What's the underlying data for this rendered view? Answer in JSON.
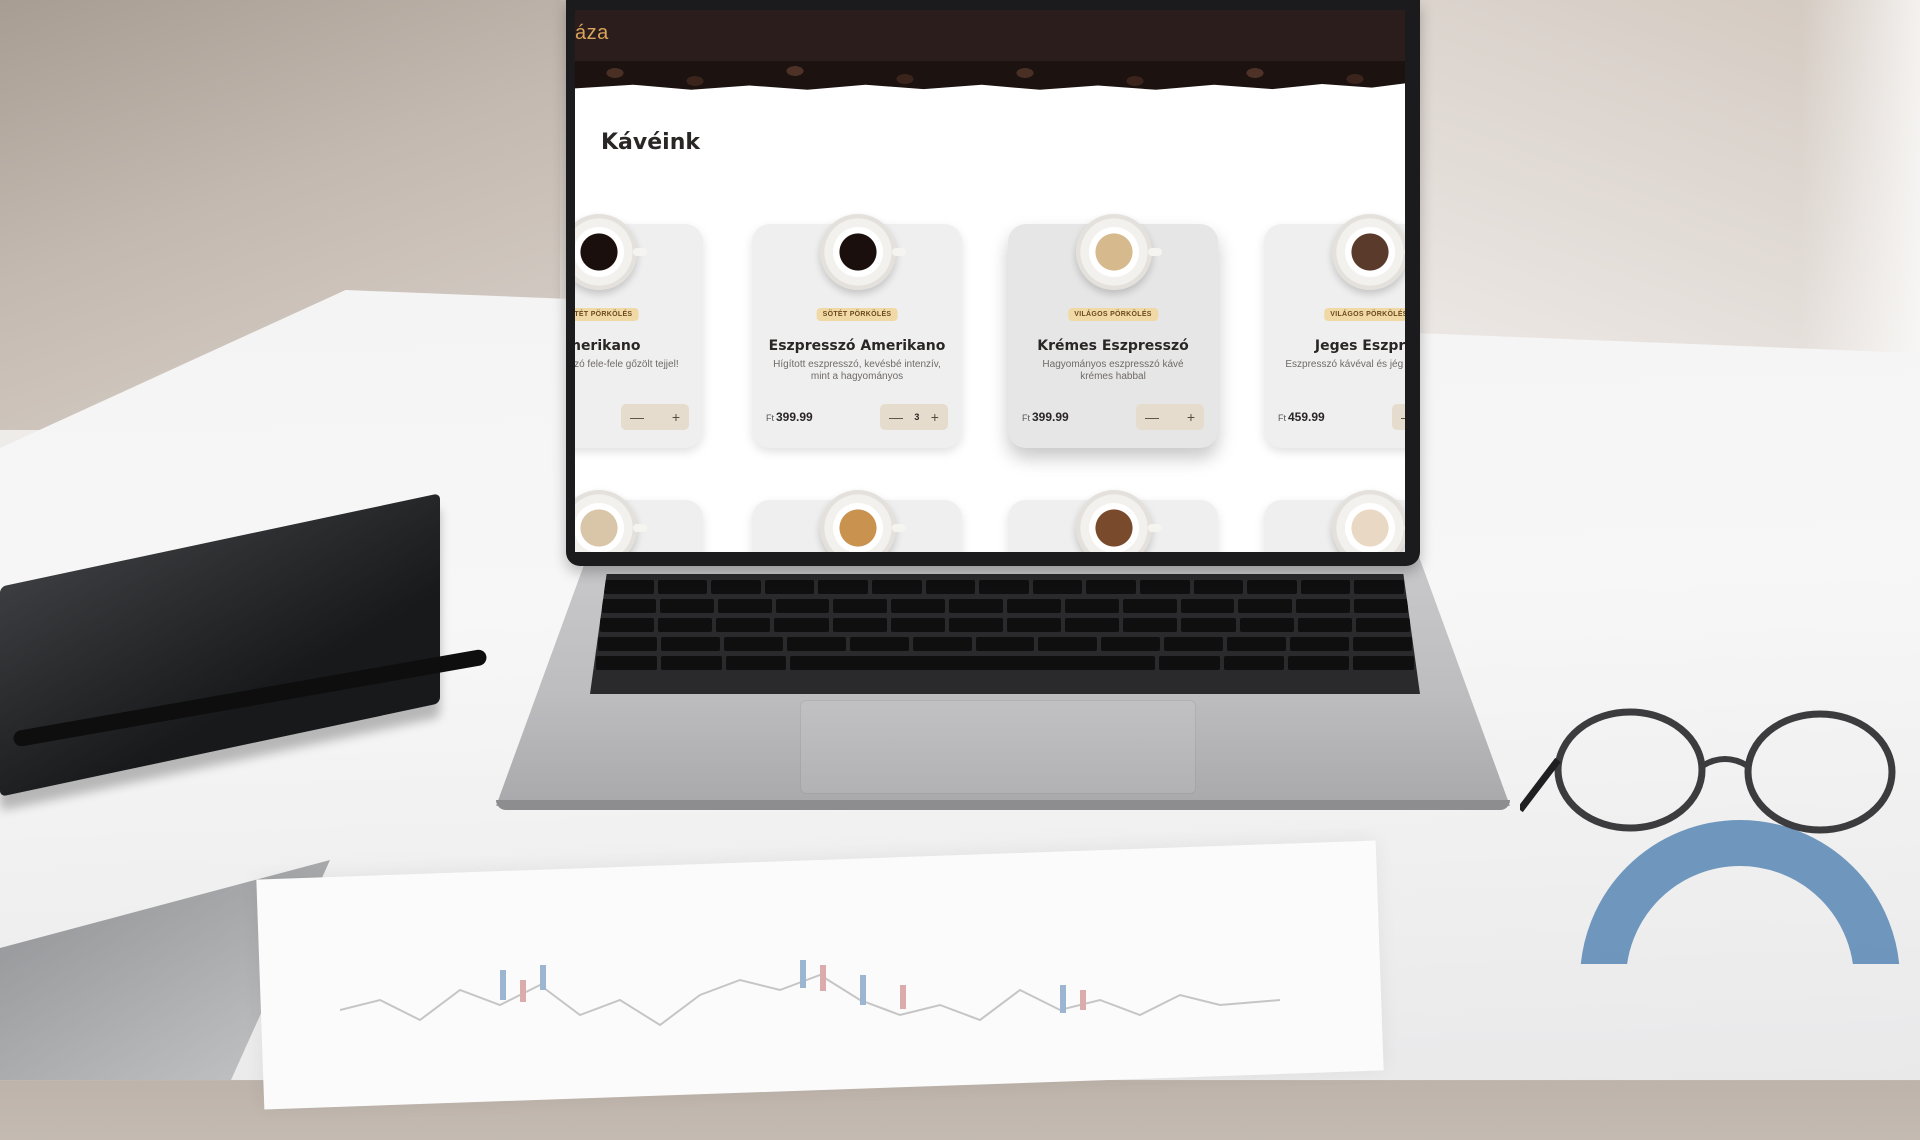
{
  "site": {
    "nav_title": "áza"
  },
  "main": {
    "section_title": "Kávéink",
    "products": [
      {
        "badge": "SÖTÉT PÖRKÖLÉS",
        "title": "Amerikano",
        "description": "ros eszpresszó fele-fele gőzölt tejjel!",
        "price": "",
        "currency": "",
        "quantity": "",
        "coffee_color": "#1a0f0c"
      },
      {
        "badge": "SÖTÉT PÖRKÖLÉS",
        "title": "Eszpresszó Amerikano",
        "description": "Hígított eszpresszó, kevésbé intenzív, mint a hagyományos",
        "price": "399.99",
        "currency": "Ft",
        "quantity": "3",
        "coffee_color": "#1a0f0c"
      },
      {
        "badge": "VILÁGOS PÖRKÖLÉS",
        "title": "Krémes Eszpresszó",
        "description": "Hagyományos eszpresszó kávé krémes habbal",
        "price": "399.99",
        "currency": "Ft",
        "quantity": "",
        "coffee_color": "#d6b98c"
      },
      {
        "badge": "VILÁGOS PÖRKÖLÉS",
        "title": "Jeges Eszpres",
        "description": "Eszpresszó kávéval és jég készült ital",
        "price": "459.99",
        "currency": "Ft",
        "quantity": "",
        "coffee_color": "#5a3a2a"
      }
    ],
    "row2_coffee_colors": [
      "#d9c6a8",
      "#c9924f",
      "#7a4a2c",
      "#e9d8c4"
    ]
  },
  "stepper": {
    "minus": "—",
    "plus": "+"
  }
}
